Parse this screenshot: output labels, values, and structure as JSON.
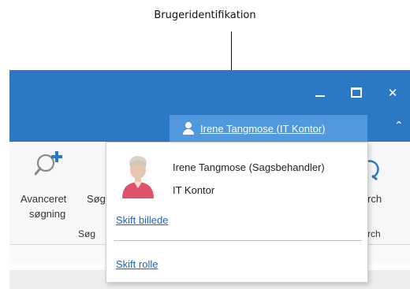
{
  "callout": {
    "label": "Brugeridentifikation"
  },
  "window_controls": {
    "minimize_icon": "minimize-icon",
    "maximize_icon": "maximize-icon",
    "close_glyph": "✕"
  },
  "user_menu": {
    "label": "Irene Tangmose (IT Kontor)",
    "icon": "user-icon"
  },
  "collapse_glyph": "⌃",
  "ribbon": {
    "advanced_search_line1": "Avanceret",
    "advanced_search_line2": "søgning",
    "search_partial": "Søg",
    "group_label": "Søg",
    "right_partial_top": "rch",
    "right_partial_bottom": "rch"
  },
  "dropdown": {
    "user_full": "Irene Tangmose (Sagsbehandler)",
    "organization": "IT Kontor",
    "change_picture": "Skift billede",
    "change_role": "Skift rolle"
  },
  "colors": {
    "titlebar": "#2b78c5",
    "user_menu_bg": "#5199dc",
    "link": "#1a66c2"
  }
}
